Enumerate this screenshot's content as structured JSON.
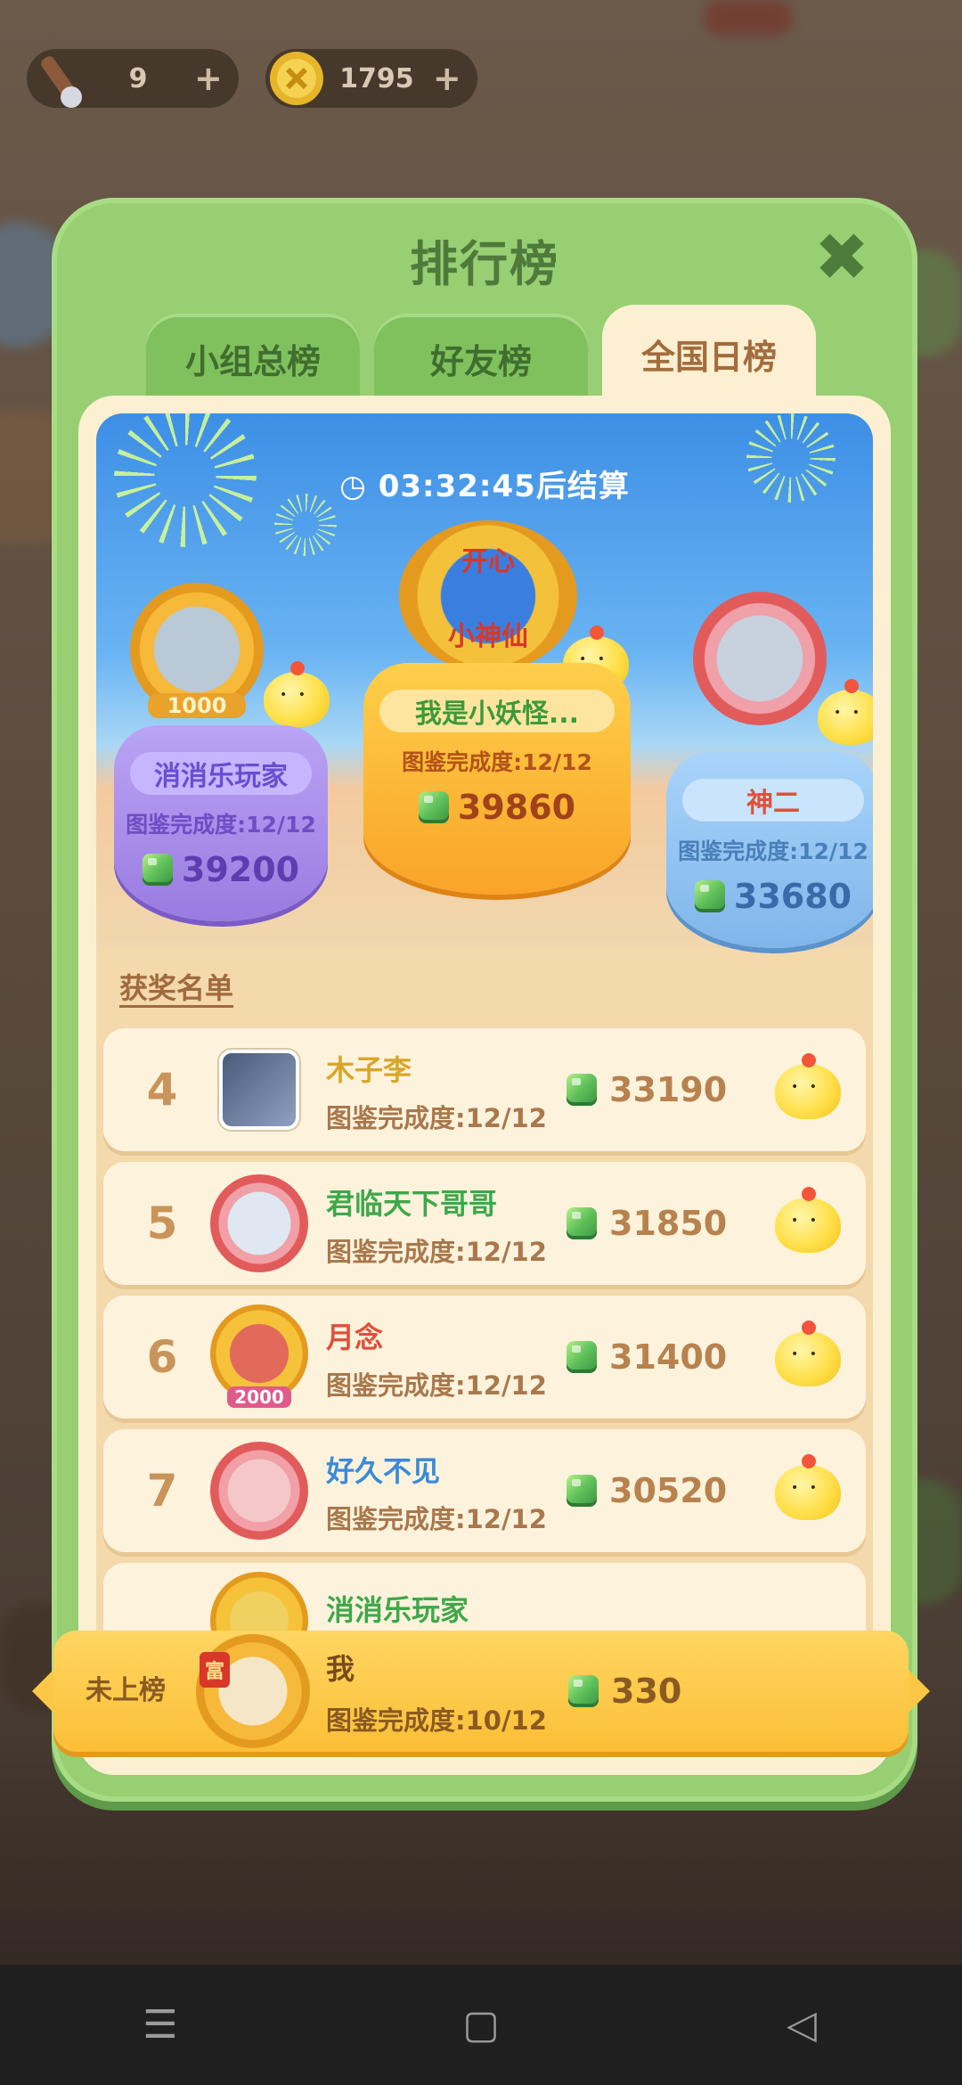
{
  "resources": [
    {
      "icon": "torch-icon",
      "value": "9"
    },
    {
      "icon": "coin-icon",
      "value": "1795"
    }
  ],
  "modal": {
    "title": "排行榜",
    "close": "✖",
    "tabs": [
      "小组总榜",
      "好友榜",
      "全国日榜"
    ],
    "active_tab": 2
  },
  "timer": "03:32:45后结算",
  "podium": {
    "first": {
      "name": "我是小妖怪...",
      "progress": "图鉴完成度:12/12",
      "score": "39860"
    },
    "second": {
      "name": "消消乐玩家",
      "progress": "图鉴完成度:12/12",
      "score": "39200",
      "badge": "1000"
    },
    "third": {
      "name": "神二",
      "progress": "图鉴完成度:12/12",
      "score": "33680"
    },
    "emblem": [
      "开心",
      "小神仙"
    ]
  },
  "awards_label": "获奖名单",
  "ranks": [
    {
      "rank": "4",
      "name": "木子李",
      "progress": "图鉴完成度:12/12",
      "score": "33190"
    },
    {
      "rank": "5",
      "name": "君临天下哥哥",
      "progress": "图鉴完成度:12/12",
      "score": "31850"
    },
    {
      "rank": "6",
      "name": "月念",
      "progress": "图鉴完成度:12/12",
      "score": "31400",
      "badge": "2000"
    },
    {
      "rank": "7",
      "name": "好久不见",
      "progress": "图鉴完成度:12/12",
      "score": "30520"
    },
    {
      "rank": "",
      "name": "消消乐玩家",
      "progress": "",
      "score": ""
    }
  ],
  "me": {
    "rank": "未上榜",
    "name": "我",
    "progress": "图鉴完成度:10/12",
    "score": "330",
    "avatar_char": "富"
  },
  "nav": {
    "menu": "☰",
    "home": "▢",
    "back": "◁"
  },
  "colors": {
    "modal_green": "#97cf72",
    "panel_cream": "#fdf0d2",
    "gold": "#fbbf36",
    "first": "#f9a428",
    "second": "#a88be8",
    "third": "#7fb6ea"
  }
}
